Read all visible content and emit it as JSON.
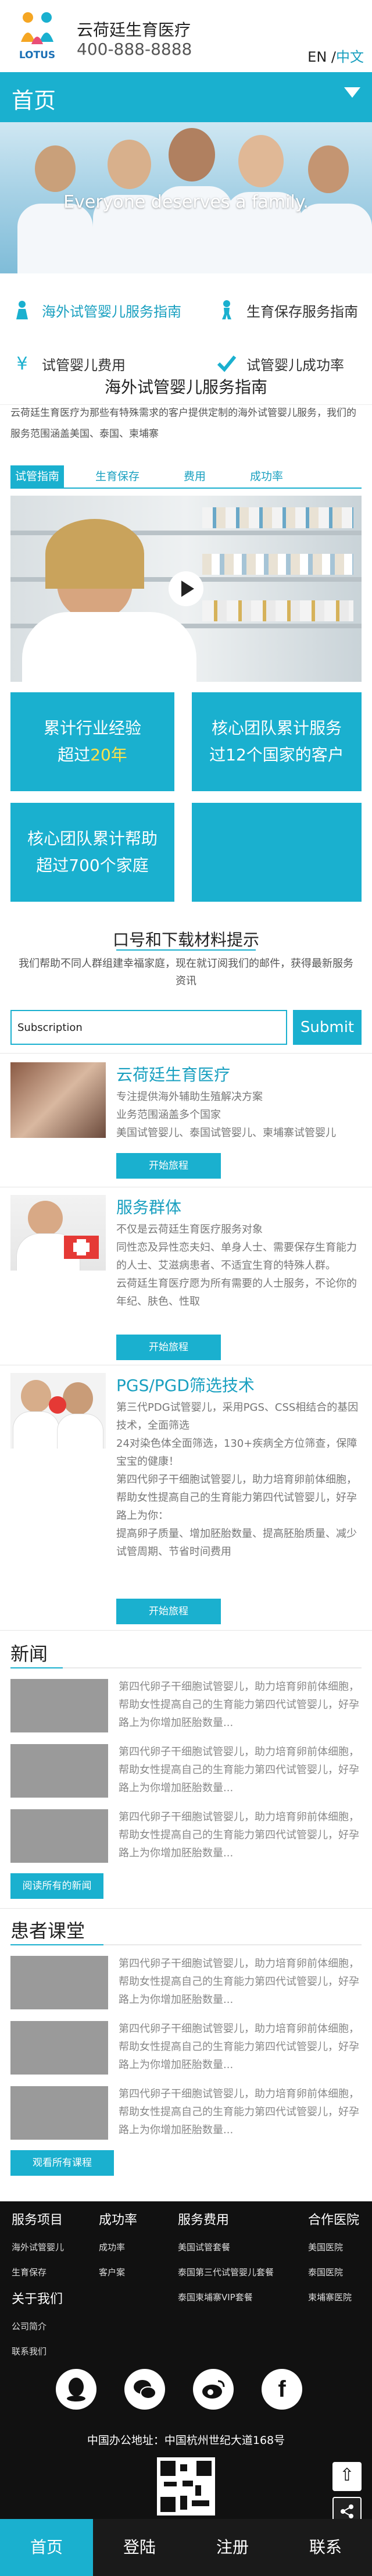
{
  "header": {
    "brand_name": "云荷廷生育医疗",
    "phone": "400-888-8888",
    "logo_text": "LOTUS",
    "lang_en": "EN",
    "lang_sep": " /",
    "lang_cn": "中文"
  },
  "navbar": {
    "title": "首页",
    "menu_icon": "triangle-down-icon"
  },
  "hero": {
    "caption": "Everyone deserves a family."
  },
  "quick_links": [
    {
      "label": "海外试管婴儿服务指南",
      "icon": "baby-icon"
    },
    {
      "label": "生育保存服务指南",
      "icon": "person-icon"
    },
    {
      "label": "试管婴儿费用",
      "icon": "yen-icon"
    },
    {
      "label": "试管婴儿成功率",
      "icon": "check-icon"
    }
  ],
  "guide": {
    "title": "海外试管婴儿服务指南",
    "intro": "云荷廷生育医疗为那些有特殊需求的客户提供定制的海外试管婴儿服务，我们的服务范围涵盖美国、泰国、柬埔寨",
    "tabs": [
      "试管指南",
      "生育保存",
      "费用",
      "成功率"
    ]
  },
  "stats": {
    "s1_line1": "累计行业经验",
    "s1_pre": "超过",
    "s1_highlight": "20年",
    "s2_line1": "核心团队累计服务",
    "s2_line2": "过12个国家的客户",
    "s3_line1": "核心团队累计帮助",
    "s3_line2": "超过700个家庭"
  },
  "download": {
    "title": "口号和下载材料提示",
    "subtitle": "我们帮助不同人群组建幸福家庭，现在就订阅我们的邮件，获得最新服务资讯",
    "input_value": "Subscription",
    "button": "Submit"
  },
  "services": [
    {
      "title": "云荷廷生育医疗",
      "lines": [
        "专注提供海外辅助生殖解决方案",
        "业务范围涵盖多个国家",
        "美国试管婴儿、泰国试管婴儿、柬埔寨试管婴儿"
      ],
      "button": "开始旅程"
    },
    {
      "title": "服务群体",
      "lines": [
        "不仅是云荷廷生育医疗服务对象",
        "同性恋及异性恋夫妇、单身人士、需要保存生育能力的人士、艾滋病患者、不适宜生育的特殊人群。",
        "云荷廷生育医疗愿为所有需要的人士服务，不论你的年纪、肤色、性取"
      ],
      "button": "开始旅程"
    },
    {
      "title": "PGS/PGD筛选技术",
      "lines": [
        "第三代PDG试管婴儿，采用PGS、CSS相结合的基因技术，全面筛选",
        "24对染色体全面筛选，130+疾病全方位筛查，保障宝宝的健康！",
        "第四代卵子干细胞试管婴儿，助力培育卵前体细胞，帮助女性提高自己的生育能力第四代试管婴儿，好孕路上为你：",
        "提高卵子质量、增加胚胎数量、提高胚胎质量、减少试管周期、节省时间费用"
      ],
      "button": "开始旅程"
    }
  ],
  "news": {
    "title": "新闻",
    "items": [
      "第四代卵子干细胞试管婴儿，助力培育卵前体细胞，帮助女性提高自己的生育能力第四代试管婴儿，好孕路上为你增加胚胎数量...",
      "第四代卵子干细胞试管婴儿，助力培育卵前体细胞，帮助女性提高自己的生育能力第四代试管婴儿，好孕路上为你增加胚胎数量...",
      "第四代卵子干细胞试管婴儿，助力培育卵前体细胞，帮助女性提高自己的生育能力第四代试管婴儿，好孕路上为你增加胚胎数量..."
    ],
    "button": "阅读所有的新闻"
  },
  "classroom": {
    "title": "患者课堂",
    "items": [
      "第四代卵子干细胞试管婴儿，助力培育卵前体细胞，帮助女性提高自己的生育能力第四代试管婴儿，好孕路上为你增加胚胎数量...",
      "第四代卵子干细胞试管婴儿，助力培育卵前体细胞，帮助女性提高自己的生育能力第四代试管婴儿，好孕路上为你增加胚胎数量...",
      "第四代卵子干细胞试管婴儿，助力培育卵前体细胞，帮助女性提高自己的生育能力第四代试管婴儿，好孕路上为你增加胚胎数量..."
    ],
    "button": "观看所有课程"
  },
  "footer": {
    "col1": {
      "title": "服务项目",
      "links": [
        "海外试管婴儿",
        "生育保存"
      ]
    },
    "col2": {
      "title": "成功率",
      "links": [
        "成功率",
        "客户案"
      ]
    },
    "col3": {
      "title": "服务费用",
      "links": [
        "美国试管套餐",
        "泰国第三代试管婴儿套餐",
        "泰国柬埔寨VIP套餐"
      ]
    },
    "col4": {
      "title": "合作医院",
      "links": [
        "美国医院",
        "泰国医院",
        "柬埔寨医院"
      ]
    },
    "col5": {
      "title": "关于我们",
      "links": [
        "公司简介",
        "联系我们"
      ]
    },
    "social_icons": [
      "qq-icon",
      "wechat-icon",
      "weibo-icon",
      "facebook-icon"
    ],
    "address": "中国办公地址：中国杭州世纪大道168号"
  },
  "bottom_nav": [
    "首页",
    "登陆",
    "注册",
    "联系"
  ]
}
